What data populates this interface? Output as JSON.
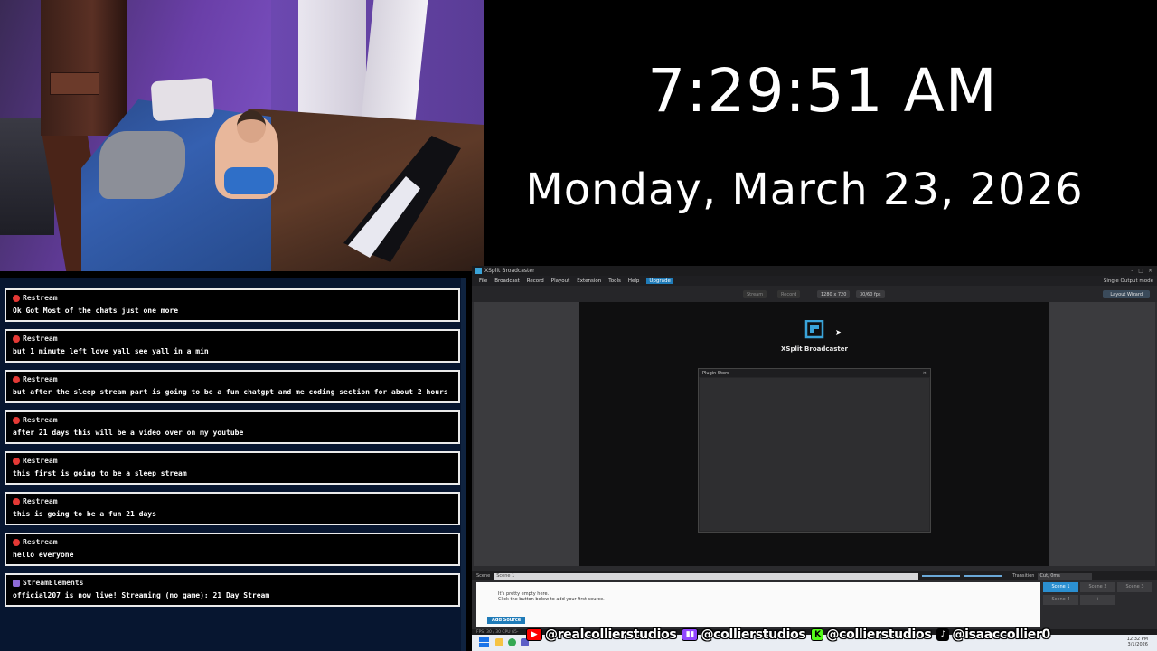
{
  "clock": {
    "time": "7:29:51 AM",
    "date": "Monday, March 23, 2026"
  },
  "chat": {
    "messages": [
      {
        "author": "Restream",
        "text": "Ok Got Most of the chats just one more",
        "icon": "restream-icon"
      },
      {
        "author": "Restream",
        "text": "but 1 minute left love yall see yall in a min",
        "icon": "restream-icon"
      },
      {
        "author": "Restream",
        "text": "but after the sleep stream part is going to be a fun chatgpt and me coding section for about 2 hours",
        "icon": "restream-icon"
      },
      {
        "author": "Restream",
        "text": "after 21 days this will be a video over on my youtube",
        "icon": "restream-icon"
      },
      {
        "author": "Restream",
        "text": "this first is going to be a sleep stream",
        "icon": "restream-icon"
      },
      {
        "author": "Restream",
        "text": "this is going to be a fun 21 days",
        "icon": "restream-icon"
      },
      {
        "author": "Restream",
        "text": "hello everyone",
        "icon": "restream-icon"
      },
      {
        "author": "StreamElements",
        "text": "official207 is now live! Streaming (no game): 21 Day Stream",
        "icon": "streamelements-icon"
      }
    ]
  },
  "xsplit": {
    "window_title": "XSplit Broadcaster",
    "menu": [
      "File",
      "Broadcast",
      "Record",
      "Playout",
      "Extension",
      "Tools",
      "Help"
    ],
    "upgrade_label": "Upgrade",
    "output_mode": "Single Output mode",
    "stream_label": "Stream",
    "record_label": "Record",
    "resolution": "1280 x 720",
    "fps": "30/60 fps",
    "layout_wizard": "Layout Wizard",
    "brand": "XSplit Broadcaster",
    "plugin_store_title": "Plugin Store",
    "scene_label": "Scene",
    "scene_name": "Scene 1",
    "transition_label": "Transition",
    "transition_value": "Cut, 0ms",
    "empty_line1": "It's pretty empty here.",
    "empty_line2": "Click the button below to add your first source.",
    "add_source": "Add Source",
    "scenes": [
      "Scene 1",
      "Scene 2",
      "Scene 3",
      "Scene 4",
      "+"
    ],
    "status": "FPS: 30 / 30   CPU (i5-",
    "accent": "#2b8fd0"
  },
  "taskbar": {
    "time": "12:32 PM",
    "date": "3/1/2026"
  },
  "socials": [
    {
      "platform": "youtube",
      "handle": "@realcollierstudios"
    },
    {
      "platform": "twitch",
      "handle": "@collierstudios"
    },
    {
      "platform": "kick",
      "handle": "@collierstudios"
    },
    {
      "platform": "tiktok",
      "handle": "@isaaccollier0"
    }
  ]
}
